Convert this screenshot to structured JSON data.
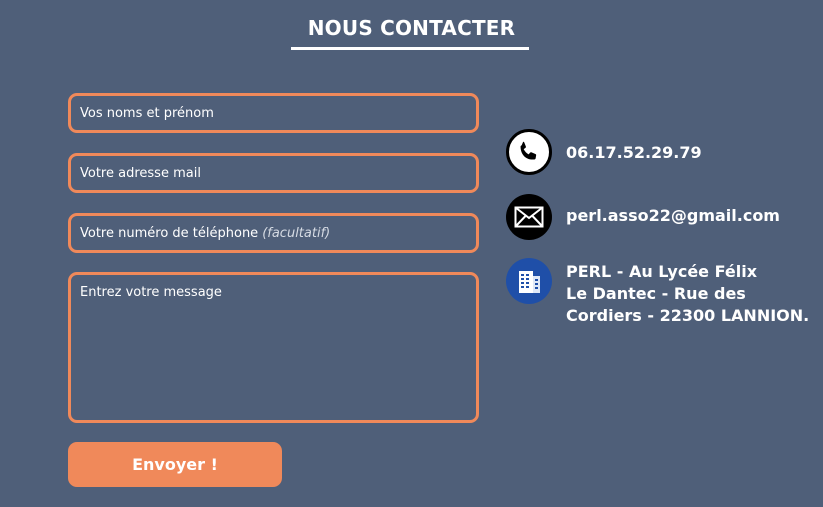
{
  "header": {
    "title": "NOUS CONTACTER"
  },
  "form": {
    "name_placeholder": "Vos noms et prénom",
    "email_placeholder": "Votre adresse mail",
    "phone_placeholder": "Votre numéro de téléphone",
    "phone_optional": "(facultatif)",
    "message_placeholder": "Entrez votre message",
    "submit_label": "Envoyer !"
  },
  "contact": {
    "phone": "06.17.52.29.79",
    "email": "perl.asso22@gmail.com",
    "address_lines": [
      "PERL - Au Lycée Félix",
      "Le Dantec - Rue des",
      "Cordiers - 22300 LANNION."
    ],
    "icons": [
      "phone-icon",
      "mail-icon",
      "building-icon"
    ]
  },
  "colors": {
    "background": "#4f5f79",
    "accent": "#f0895a",
    "text": "#ffffff",
    "building_icon_bg": "#1f4fa8"
  }
}
